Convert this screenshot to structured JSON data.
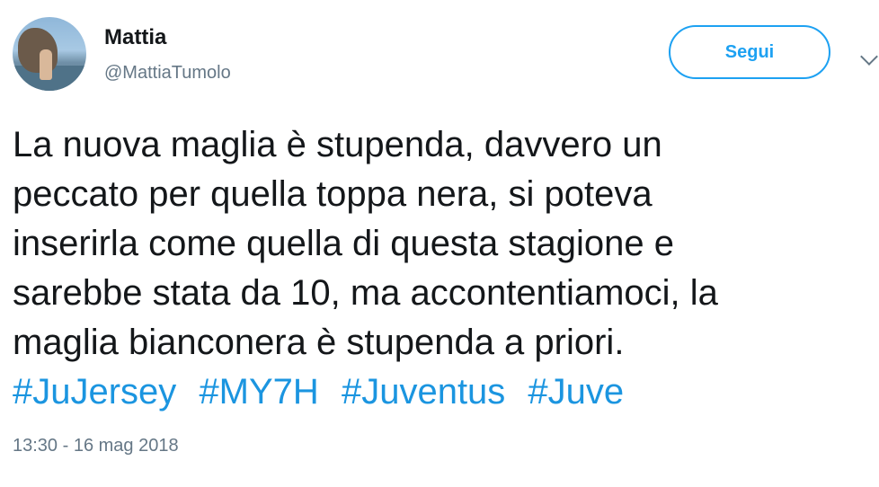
{
  "author": {
    "name": "Mattia",
    "handle": "@MattiaTumolo"
  },
  "follow_button": {
    "label": "Segui"
  },
  "menu": {
    "icon": "chevron-down-icon"
  },
  "tweet": {
    "lines": [
      "La nuova maglia è stupenda, davvero un",
      "peccato per quella toppa nera, si poteva",
      "inserirla come quella di questa stagione e",
      "sarebbe stata da 10, ma accontentiamoci, la",
      "maglia bianconera è stupenda a priori."
    ],
    "hashtags": [
      "#JuJersey",
      "#MY7H",
      "#Juventus",
      "#Juve"
    ],
    "timestamp": "13:30 - 16 mag 2018"
  },
  "colors": {
    "link": "#1b95e0",
    "follow_border": "#1da1f2",
    "secondary_text": "#657786",
    "primary_text": "#14171a"
  }
}
